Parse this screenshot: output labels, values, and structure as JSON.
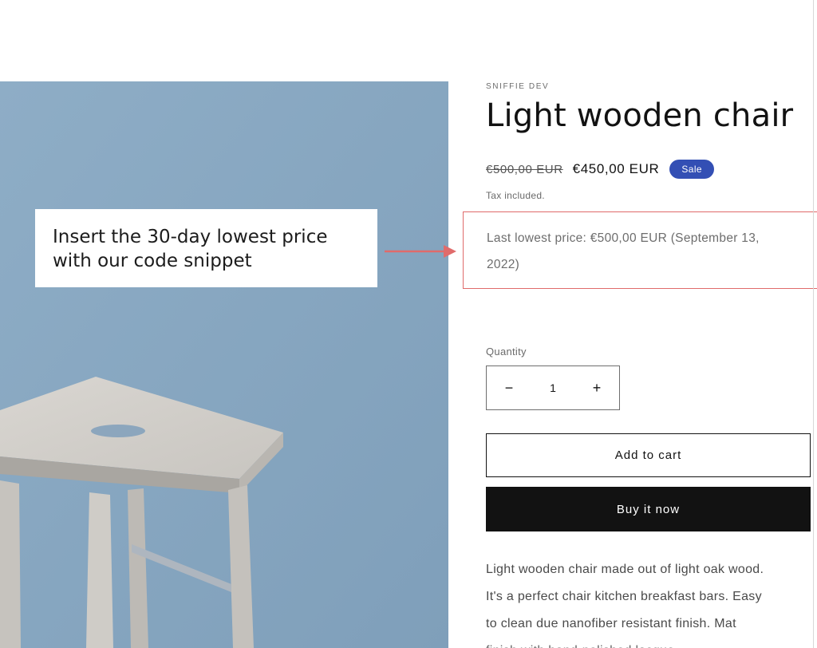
{
  "product": {
    "vendor": "SNIFFIE DEV",
    "title": "Light wooden chair",
    "price_regular": "€500,00 EUR",
    "price_sale": "€450,00 EUR",
    "badge": "Sale",
    "tax_note": "Tax included.",
    "lowest_price": {
      "line1": "Last lowest price: €500,00 EUR (September 13,",
      "line2": "2022)"
    },
    "quantity": {
      "label": "Quantity",
      "value": "1",
      "minus": "−",
      "plus": "+"
    },
    "add_to_cart": "Add to cart",
    "buy_now": "Buy it now",
    "description": [
      "Light wooden chair made out of light oak wood.",
      "It's a perfect chair kitchen breakfast bars. Easy",
      "to clean due nanofiber resistant finish. Mat",
      "finish with hand-polished lacque..."
    ]
  },
  "callout": {
    "line1": "Insert the 30-day lowest price",
    "line2": "with our code snippet"
  },
  "colors": {
    "badge": "#334fb4",
    "media_background": "#89a9c3",
    "annotation": "#e06b6b",
    "buy_button": "#121212"
  },
  "icons": {
    "arrow": "right-arrow-icon",
    "minus": "minus-icon",
    "plus": "plus-icon"
  }
}
